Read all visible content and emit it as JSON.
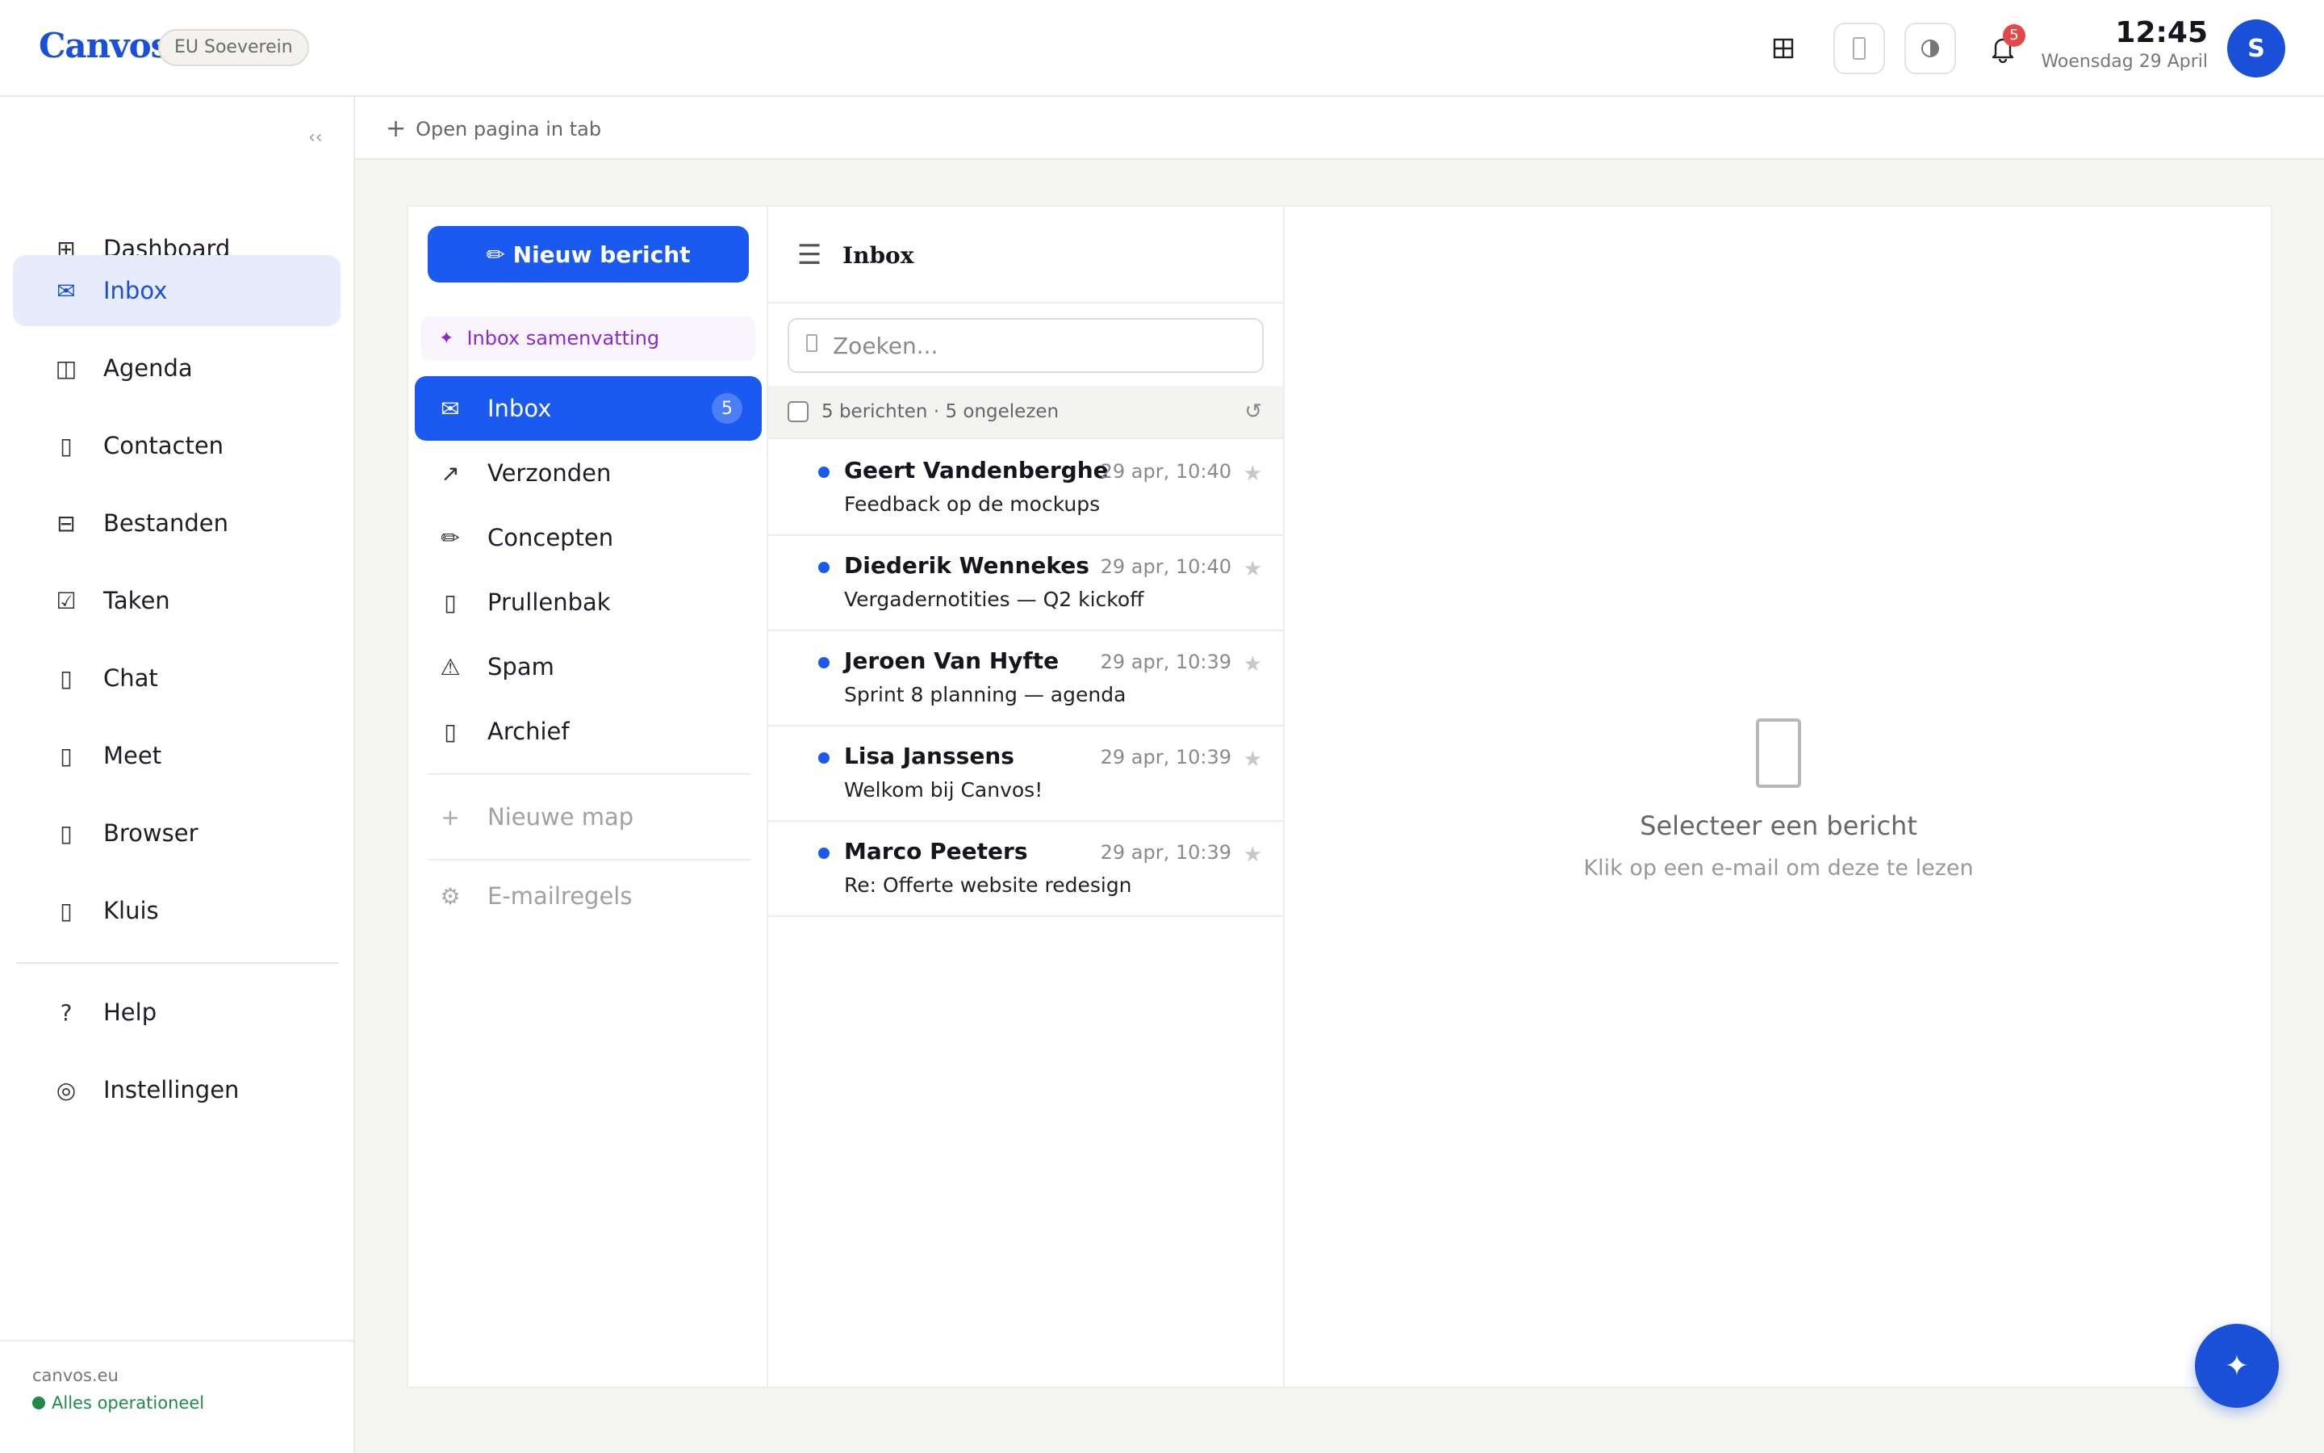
{
  "header": {
    "logo": "Canvos",
    "badge": "EU Soeverein",
    "notification_count": "5",
    "time": "12:45",
    "date": "Woensdag 29 April",
    "avatar_initial": "S",
    "icons": [
      "grid-icon",
      "phone-icon",
      "contrast-icon",
      "bell-icon"
    ]
  },
  "sidebar": {
    "collapse_label": "‹‹",
    "items": [
      {
        "label": "Dashboard",
        "icon": "⊞"
      },
      {
        "label": "Inbox",
        "icon": "✉"
      },
      {
        "label": "Agenda",
        "icon": "◫"
      },
      {
        "label": "Contacten",
        "icon": "▯"
      },
      {
        "label": "Bestanden",
        "icon": "⊟"
      },
      {
        "label": "Taken",
        "icon": "☑"
      },
      {
        "label": "Chat",
        "icon": "▯"
      },
      {
        "label": "Meet",
        "icon": "▯"
      },
      {
        "label": "Browser",
        "icon": "▯"
      },
      {
        "label": "Kluis",
        "icon": "▯"
      }
    ],
    "bottom_items": [
      {
        "label": "Help",
        "icon": "?"
      },
      {
        "label": "Instellingen",
        "icon": "◎"
      }
    ],
    "footer_domain": "canvos.eu",
    "footer_status": "Alles operationeel",
    "active_item": "Inbox"
  },
  "tabstrip": {
    "open_tab_label": "Open pagina in tab"
  },
  "mail": {
    "new_message_label": "✏ Nieuw bericht",
    "summary_label": "Inbox samenvatting",
    "folders": [
      {
        "label": "Inbox",
        "icon": "✉",
        "count": "5"
      },
      {
        "label": "Verzonden",
        "icon": "↗"
      },
      {
        "label": "Concepten",
        "icon": "✏"
      },
      {
        "label": "Prullenbak",
        "icon": "▯"
      },
      {
        "label": "Spam",
        "icon": "⚠"
      },
      {
        "label": "Archief",
        "icon": "▯"
      }
    ],
    "new_folder_label": "Nieuwe map",
    "rules_label": "E-mailregels",
    "list_title": "Inbox",
    "search_placeholder": "Zoeken...",
    "list_summary": "5 berichten · 5 ongelezen",
    "messages": [
      {
        "from": "Geert Vandenberghe",
        "date": "29 apr, 10:40",
        "subject": "Feedback op de mockups"
      },
      {
        "from": "Diederik Wennekes",
        "date": "29 apr, 10:40",
        "subject": "Vergadernotities — Q2 kickoff"
      },
      {
        "from": "Jeroen Van Hyfte",
        "date": "29 apr, 10:39",
        "subject": "Sprint 8 planning — agenda"
      },
      {
        "from": "Lisa Janssens",
        "date": "29 apr, 10:39",
        "subject": "Welkom bij Canvos!"
      },
      {
        "from": "Marco Peeters",
        "date": "29 apr, 10:39",
        "subject": "Re: Offerte website redesign"
      }
    ],
    "reader_title": "Selecteer een bericht",
    "reader_subtitle": "Klik op een e-mail om deze te lezen"
  },
  "colors": {
    "accent": "#1a5af0",
    "brand": "#1a4fd8",
    "status_ok": "#1f8a4c",
    "summary_purple": "#8b2bc6"
  }
}
